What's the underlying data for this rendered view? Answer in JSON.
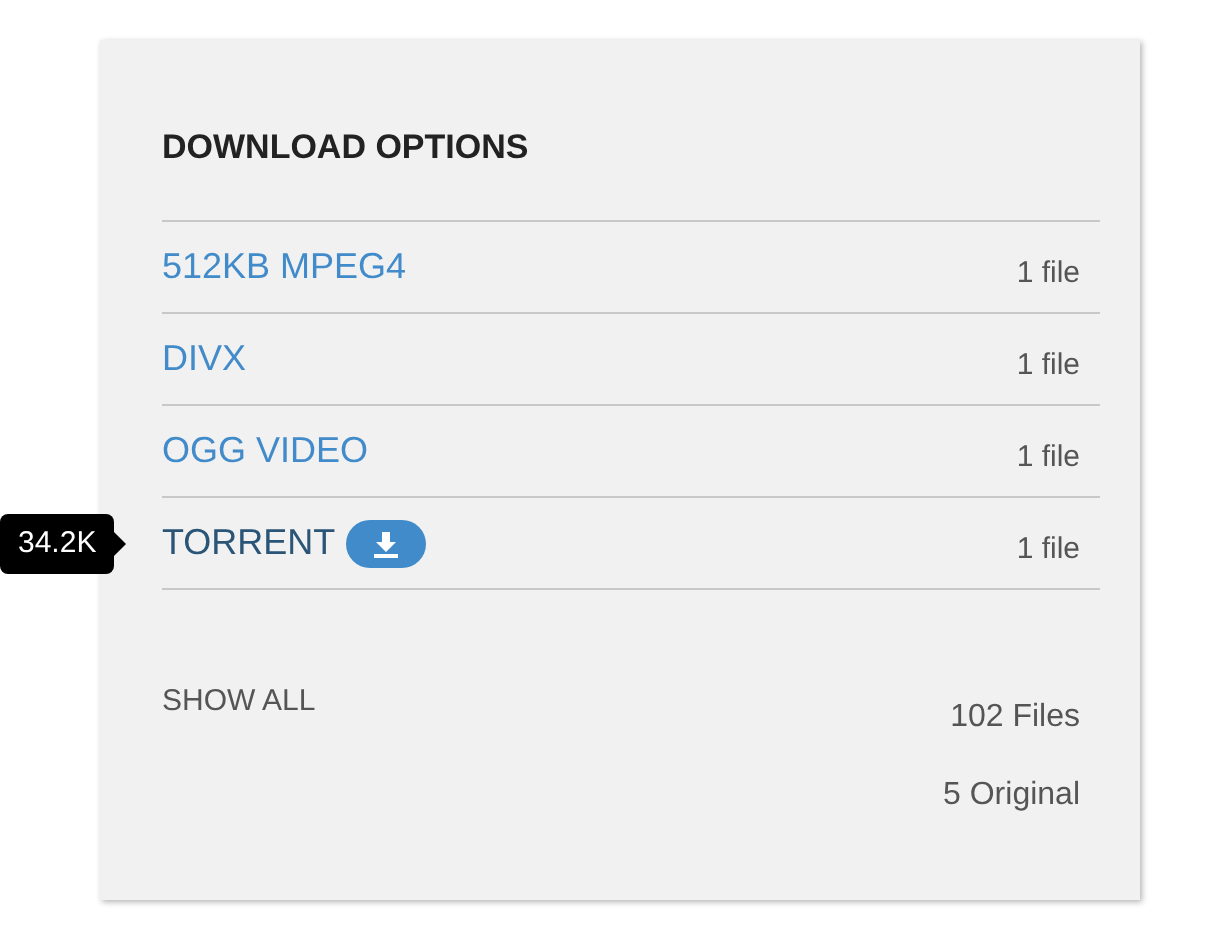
{
  "title": "DOWNLOAD OPTIONS",
  "options": [
    {
      "label": "512KB MPEG4",
      "count": "1 file",
      "highlighted": false
    },
    {
      "label": "DIVX",
      "count": "1 file",
      "highlighted": false
    },
    {
      "label": "OGG VIDEO",
      "count": "1 file",
      "highlighted": false
    },
    {
      "label": "TORRENT",
      "count": "1 file",
      "highlighted": true,
      "tooltip": "34.2K",
      "download_badge": true
    }
  ],
  "show_all": "SHOW ALL",
  "totals": [
    "102 Files",
    "5 Original"
  ]
}
